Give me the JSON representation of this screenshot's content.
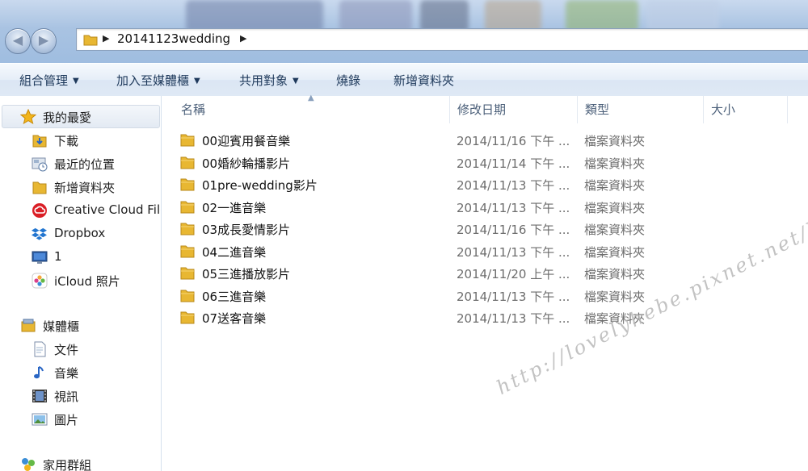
{
  "address_bar": {
    "path": "20141123wedding"
  },
  "command_bar": {
    "organize": "組合管理",
    "add_to_library": "加入至媒體櫃",
    "share_with": "共用對象",
    "burn": "燒錄",
    "new_folder": "新增資料夾"
  },
  "nav": {
    "favorites_label": "我的最愛",
    "favorites": [
      {
        "label": "下載",
        "icon": "download-folder-icon"
      },
      {
        "label": "最近的位置",
        "icon": "recent-places-icon"
      },
      {
        "label": "新增資料夾",
        "icon": "folder-icon"
      },
      {
        "label": "Creative Cloud Files",
        "icon": "creative-cloud-icon"
      },
      {
        "label": "Dropbox",
        "icon": "dropbox-icon"
      },
      {
        "label": "1",
        "icon": "desktop-icon"
      },
      {
        "label": "iCloud 照片",
        "icon": "icloud-photos-icon"
      }
    ],
    "libraries_label": "媒體櫃",
    "libraries": [
      {
        "label": "文件",
        "icon": "documents-icon"
      },
      {
        "label": "音樂",
        "icon": "music-icon"
      },
      {
        "label": "視訊",
        "icon": "video-icon"
      },
      {
        "label": "圖片",
        "icon": "pictures-icon"
      }
    ],
    "homegroup_label": "家用群組"
  },
  "columns": {
    "name": "名稱",
    "date": "修改日期",
    "type": "類型",
    "size": "大小"
  },
  "files": [
    {
      "name": "00迎賓用餐音樂",
      "date": "2014/11/16 下午 ...",
      "type": "檔案資料夾"
    },
    {
      "name": "00婚紗輪播影片",
      "date": "2014/11/14 下午 ...",
      "type": "檔案資料夾"
    },
    {
      "name": "01pre-wedding影片",
      "date": "2014/11/13 下午 ...",
      "type": "檔案資料夾"
    },
    {
      "name": "02一進音樂",
      "date": "2014/11/13 下午 ...",
      "type": "檔案資料夾"
    },
    {
      "name": "03成長愛情影片",
      "date": "2014/11/16 下午 ...",
      "type": "檔案資料夾"
    },
    {
      "name": "04二進音樂",
      "date": "2014/11/13 下午 ...",
      "type": "檔案資料夾"
    },
    {
      "name": "05三進播放影片",
      "date": "2014/11/20 上午 ...",
      "type": "檔案資料夾"
    },
    {
      "name": "06三進音樂",
      "date": "2014/11/13 下午 ...",
      "type": "檔案資料夾"
    },
    {
      "name": "07送客音樂",
      "date": "2014/11/13 下午 ...",
      "type": "檔案資料夾"
    }
  ],
  "watermark": "http://lovelyhebe.pixnet.net/blog",
  "colors": {
    "folder": "#e8b732",
    "accent": "#1e395b",
    "star": "#f2b51c"
  }
}
